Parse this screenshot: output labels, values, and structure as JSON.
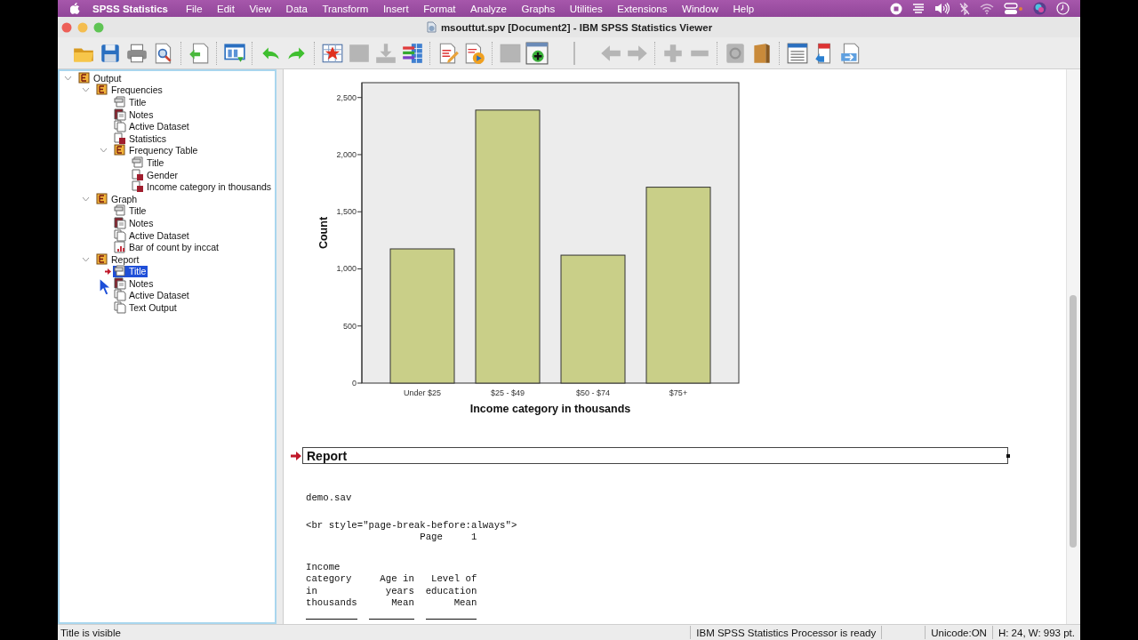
{
  "menubar": {
    "app": "SPSS Statistics",
    "menus": [
      "File",
      "Edit",
      "View",
      "Data",
      "Transform",
      "Insert",
      "Format",
      "Analyze",
      "Graphs",
      "Utilities",
      "Extensions",
      "Window",
      "Help"
    ]
  },
  "window": {
    "title": "msouttut.spv [Document2] - IBM SPSS Statistics Viewer"
  },
  "toolbar": [
    [
      {
        "kind": "open",
        "disabled": false
      },
      {
        "kind": "save",
        "disabled": false
      },
      {
        "kind": "print",
        "disabled": false
      },
      {
        "kind": "preview",
        "disabled": false
      }
    ],
    [
      {
        "kind": "export",
        "disabled": false
      }
    ],
    [
      {
        "kind": "gotodata",
        "disabled": false
      }
    ],
    [
      {
        "kind": "undo",
        "disabled": false
      },
      {
        "kind": "redo",
        "disabled": false
      }
    ],
    [
      {
        "kind": "insert",
        "disabled": false
      },
      {
        "kind": "image",
        "disabled": true
      },
      {
        "kind": "import",
        "disabled": true
      },
      {
        "kind": "variables",
        "disabled": false
      }
    ],
    [
      {
        "kind": "editdoc",
        "disabled": false
      },
      {
        "kind": "rundoc",
        "disabled": false
      }
    ],
    [
      {
        "kind": "square",
        "disabled": true
      },
      {
        "kind": "designate",
        "disabled": false
      }
    ],
    [
      {
        "kind": "back",
        "disabled": true
      },
      {
        "kind": "forward",
        "disabled": true
      }
    ],
    [
      {
        "kind": "expand",
        "disabled": true
      },
      {
        "kind": "collapse",
        "disabled": true
      }
    ],
    [
      {
        "kind": "safe",
        "disabled": true
      },
      {
        "kind": "book",
        "disabled": false
      }
    ],
    [
      {
        "kind": "list",
        "disabled": false
      },
      {
        "kind": "docred",
        "disabled": false
      },
      {
        "kind": "docblue",
        "disabled": false
      }
    ]
  ],
  "outline": [
    {
      "label": "Output",
      "kind": "book",
      "expanded": true,
      "selected": false,
      "children": [
        {
          "label": "Frequencies",
          "kind": "book",
          "expanded": true,
          "selected": false,
          "children": [
            {
              "label": "Title",
              "kind": "title",
              "selected": false
            },
            {
              "label": "Notes",
              "kind": "notes",
              "selected": false
            },
            {
              "label": "Active Dataset",
              "kind": "log",
              "selected": false
            },
            {
              "label": "Statistics",
              "kind": "table",
              "selected": false
            },
            {
              "label": "Frequency Table",
              "kind": "book",
              "expanded": true,
              "selected": false,
              "children": [
                {
                  "label": "Title",
                  "kind": "title",
                  "selected": false
                },
                {
                  "label": "Gender",
                  "kind": "table",
                  "selected": false
                },
                {
                  "label": "Income category in thousands",
                  "kind": "table",
                  "selected": false
                }
              ]
            }
          ]
        },
        {
          "label": "Graph",
          "kind": "book",
          "expanded": true,
          "selected": false,
          "children": [
            {
              "label": "Title",
              "kind": "title",
              "selected": false
            },
            {
              "label": "Notes",
              "kind": "notes",
              "selected": false
            },
            {
              "label": "Active Dataset",
              "kind": "log",
              "selected": false
            },
            {
              "label": "Bar of count by inccat",
              "kind": "chart",
              "selected": false
            }
          ]
        },
        {
          "label": "Report",
          "kind": "book",
          "expanded": true,
          "selected": false,
          "children": [
            {
              "label": "Title",
              "kind": "title",
              "selected": true
            },
            {
              "label": "Notes",
              "kind": "notes",
              "selected": false
            },
            {
              "label": "Active Dataset",
              "kind": "log",
              "selected": false
            },
            {
              "label": "Text Output",
              "kind": "log",
              "selected": false
            }
          ]
        }
      ]
    }
  ],
  "chart": {
    "chart_data": {
      "type": "bar",
      "xlabel": "Income category in thousands",
      "ylabel": "Count",
      "categories": [
        "Under $25",
        "$25 - $49",
        "$50 - $74",
        "$75+"
      ],
      "values": [
        1175,
        2390,
        1120,
        1715
      ],
      "ylim": [
        0,
        2630
      ],
      "yticks": [
        {
          "value": 0,
          "label": "0"
        },
        {
          "value": 500,
          "label": "500"
        },
        {
          "value": 1000,
          "label": "1,000"
        },
        {
          "value": 1500,
          "label": "1,500"
        },
        {
          "value": 2000,
          "label": "2,000"
        },
        {
          "value": 2500,
          "label": "2,500"
        }
      ]
    }
  },
  "report": {
    "heading": "Report",
    "current": true,
    "file": "demo.sav",
    "markup": "<br style=\"page-break-before:always\">",
    "page_label": "Page",
    "page_number": "1",
    "columns": [
      {
        "heading": "Income\ncategory\nin\nthousands"
      },
      {
        "heading": "Age in\nyears\nMean"
      },
      {
        "heading": "Level of\neducation\nMean"
      }
    ]
  },
  "status_bar": {
    "message": "Title is visible",
    "processor": "IBM SPSS Statistics Processor is ready",
    "unicode": "Unicode:ON",
    "dimensions": "H: 24, W: 993 pt."
  }
}
